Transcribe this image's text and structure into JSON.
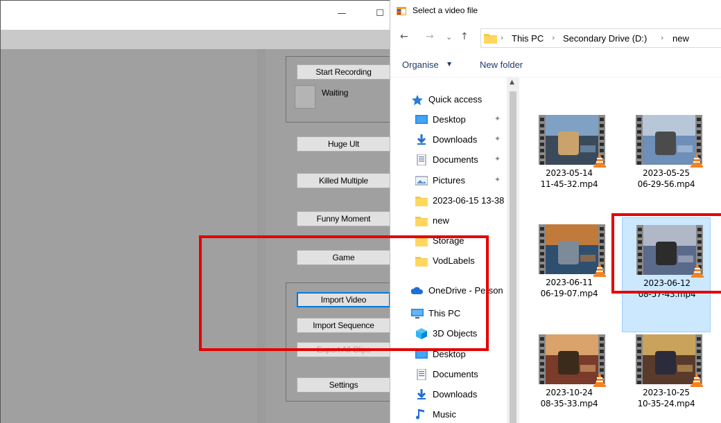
{
  "app": {
    "window_controls": {
      "minimize": "—",
      "maximize": "☐"
    },
    "recording": {
      "start_label": "Start Recording",
      "status": "Waiting"
    },
    "markers": [
      {
        "label": "Huge Ult"
      },
      {
        "label": "Killed Multiple"
      },
      {
        "label": "Funny Moment"
      },
      {
        "label": "Game"
      }
    ],
    "import_group": {
      "import_video": "Import Video",
      "import_sequence": "Import Sequence",
      "export_all": "Export All Clips",
      "settings": "Settings"
    }
  },
  "dialog": {
    "title": "Select a video file",
    "nav": {
      "back": "←",
      "forward": "→",
      "recent": "⌄",
      "up": "↑"
    },
    "breadcrumb": [
      "This PC",
      "Secondary Drive (D:)",
      "new"
    ],
    "commands": {
      "organise": "Organise",
      "new_folder": "New folder"
    },
    "nav_items": [
      {
        "label": "Quick access",
        "icon": "star-icon",
        "pinned": false
      },
      {
        "label": "Desktop",
        "icon": "desktop-icon",
        "pinned": true
      },
      {
        "label": "Downloads",
        "icon": "download-icon",
        "pinned": true
      },
      {
        "label": "Documents",
        "icon": "document-icon",
        "pinned": true
      },
      {
        "label": "Pictures",
        "icon": "pictures-icon",
        "pinned": true
      },
      {
        "label": "2023-06-15 13-38",
        "icon": "folder-icon",
        "pinned": false
      },
      {
        "label": "new",
        "icon": "folder-icon",
        "pinned": false
      },
      {
        "label": "Storage",
        "icon": "folder-icon",
        "pinned": false
      },
      {
        "label": "VodLabels",
        "icon": "folder-icon",
        "pinned": false
      },
      {
        "label": "OneDrive - Person",
        "icon": "onedrive-icon",
        "pinned": false
      },
      {
        "label": "This PC",
        "icon": "computer-icon",
        "pinned": false
      },
      {
        "label": "3D Objects",
        "icon": "cube-icon",
        "pinned": false
      },
      {
        "label": "Desktop",
        "icon": "desktop-icon",
        "pinned": false
      },
      {
        "label": "Documents",
        "icon": "document-icon",
        "pinned": false
      },
      {
        "label": "Downloads",
        "icon": "download-icon",
        "pinned": false
      },
      {
        "label": "Music",
        "icon": "music-icon",
        "pinned": false
      }
    ],
    "pin_glyph": "📌",
    "files": [
      {
        "line1": "2023-05-14",
        "line2": "11-45-32.mp4",
        "selected": false,
        "palette": [
          "#3b4a5a",
          "#7fa2c4",
          "#c9a36b"
        ]
      },
      {
        "line1": "2023-05-25",
        "line2": "06-29-56.mp4",
        "selected": false,
        "palette": [
          "#6d8fb8",
          "#b7c7d8",
          "#4b4b4b"
        ]
      },
      {
        "line1": "2023-06-11",
        "line2": "06-19-07.mp4",
        "selected": false,
        "palette": [
          "#2f4f6f",
          "#c07a3a",
          "#7d8a9a"
        ]
      },
      {
        "line1": "2023-06-12",
        "line2": "08-57-43.mp4",
        "selected": true,
        "palette": [
          "#5a6a8a",
          "#b0b8c8",
          "#2c2c2c"
        ]
      },
      {
        "line1": "2023-10-24",
        "line2": "08-35-33.mp4",
        "selected": false,
        "palette": [
          "#7a3b2b",
          "#d9a36b",
          "#3b2b1b"
        ]
      },
      {
        "line1": "2023-10-25",
        "line2": "10-35-24.mp4",
        "selected": false,
        "palette": [
          "#5a3b2b",
          "#c9a35b",
          "#2b2b3b"
        ]
      }
    ],
    "highlight_color": "#e30000",
    "selection_color": "#cce8ff"
  }
}
